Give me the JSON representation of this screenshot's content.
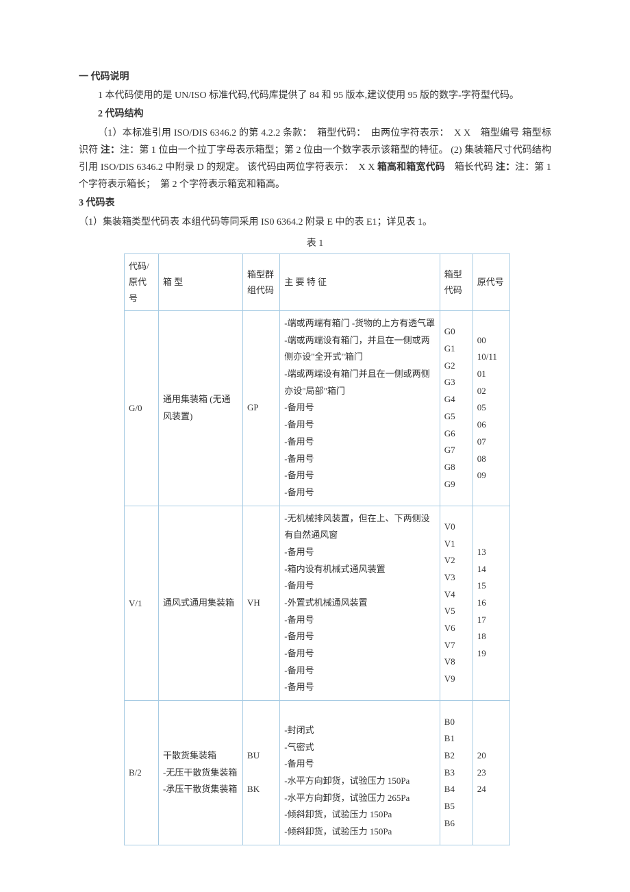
{
  "h1": "一  代码说明",
  "p1": "1  本代码使用的是 UN/ISO 标准代码,代码库提供了 84 和 95 版本,建议使用 95 版的数字-字符型代码。",
  "h2": "2  代码结构",
  "p2a": "（1）本标准引用 ISO/DIS 6346.2 的第 4.2.2 条款：　箱型代码：　由两位字符表示：　X X　箱型编号  箱型标识符  ",
  "p2a_note": "注：第 1 位由一个拉丁字母表示箱型；第 2 位由一个数字表示该箱型的特征。",
  "p2b": "  (2)  集装箱尺寸代码结构引用 ISO/DIS 6346.2 中附录 D 的规定。  该代码由两位字符表示：　X X  ",
  "p2b_bold": "箱高和箱宽代码",
  "p2b_tail": "　箱长代码  ",
  "p2b_note": "注：第 1 个字符表示箱长；　第 2 个字符表示箱宽和箱高。",
  "h3": "3  代码表",
  "p3": "（1）集装箱类型代码表  本组代码等同采用 IS0 6364.2 附录 E 中的表 E1；详见表 1。",
  "table_caption": "表  1",
  "headers": {
    "col1": "代码/原代号",
    "col2": "箱  型",
    "col3": "箱型群组代码",
    "col4": "主  要  特  征",
    "col5": "箱型代码",
    "col6": "原代号"
  },
  "rows": [
    {
      "code": "G/0",
      "type": "通用集装箱 (无通风装置)",
      "group": "GP",
      "features": "-端或两端有箱门 -货物的上方有透气罩\n-端或两端设有箱门，并且在一侧或两侧亦设\"全开式\"箱门\n-端或两端设有箱门并且在一侧或两侧亦设\"局部\"箱门\n-备用号\n-备用号\n-备用号\n-备用号\n-备用号\n-备用号",
      "typecodes": "G0\nG1\nG2\nG3\nG4\nG5\nG6\nG7\nG8\nG9",
      "orig": "00\n10/11\n01\n02\n05\n06\n07\n08\n09"
    },
    {
      "code": "V/1",
      "type": "通风式通用集装箱",
      "group": "VH",
      "features": "-无机械排风装置，但在上、下两侧没有自然通风窗\n-备用号\n-箱内设有机械式通风装置\n-备用号\n-外置式机械通风装置\n-备用号\n-备用号\n-备用号\n-备用号\n-备用号",
      "typecodes": "V0\nV1\nV2\nV3\nV4\nV5\nV6\nV7\nV8\nV9",
      "orig": "13\n14\n15\n16\n17\n18\n19"
    },
    {
      "code": "B/2",
      "type": "干散货集装箱\n-无压干散货集装箱\n-承压干散货集装箱",
      "group": "BU\n\nBK",
      "features": "\n-封闭式\n-气密式\n-备用号\n-水平方向卸货，试验压力 150Pa\n-水平方向卸货，试验压力 265Pa\n-倾斜卸货，试验压力 150Pa\n-倾斜卸货，试验压力 150Pa",
      "typecodes": "B0\nB1\nB2\nB3\nB4\nB5\nB6",
      "orig": "20\n23\n24"
    }
  ]
}
